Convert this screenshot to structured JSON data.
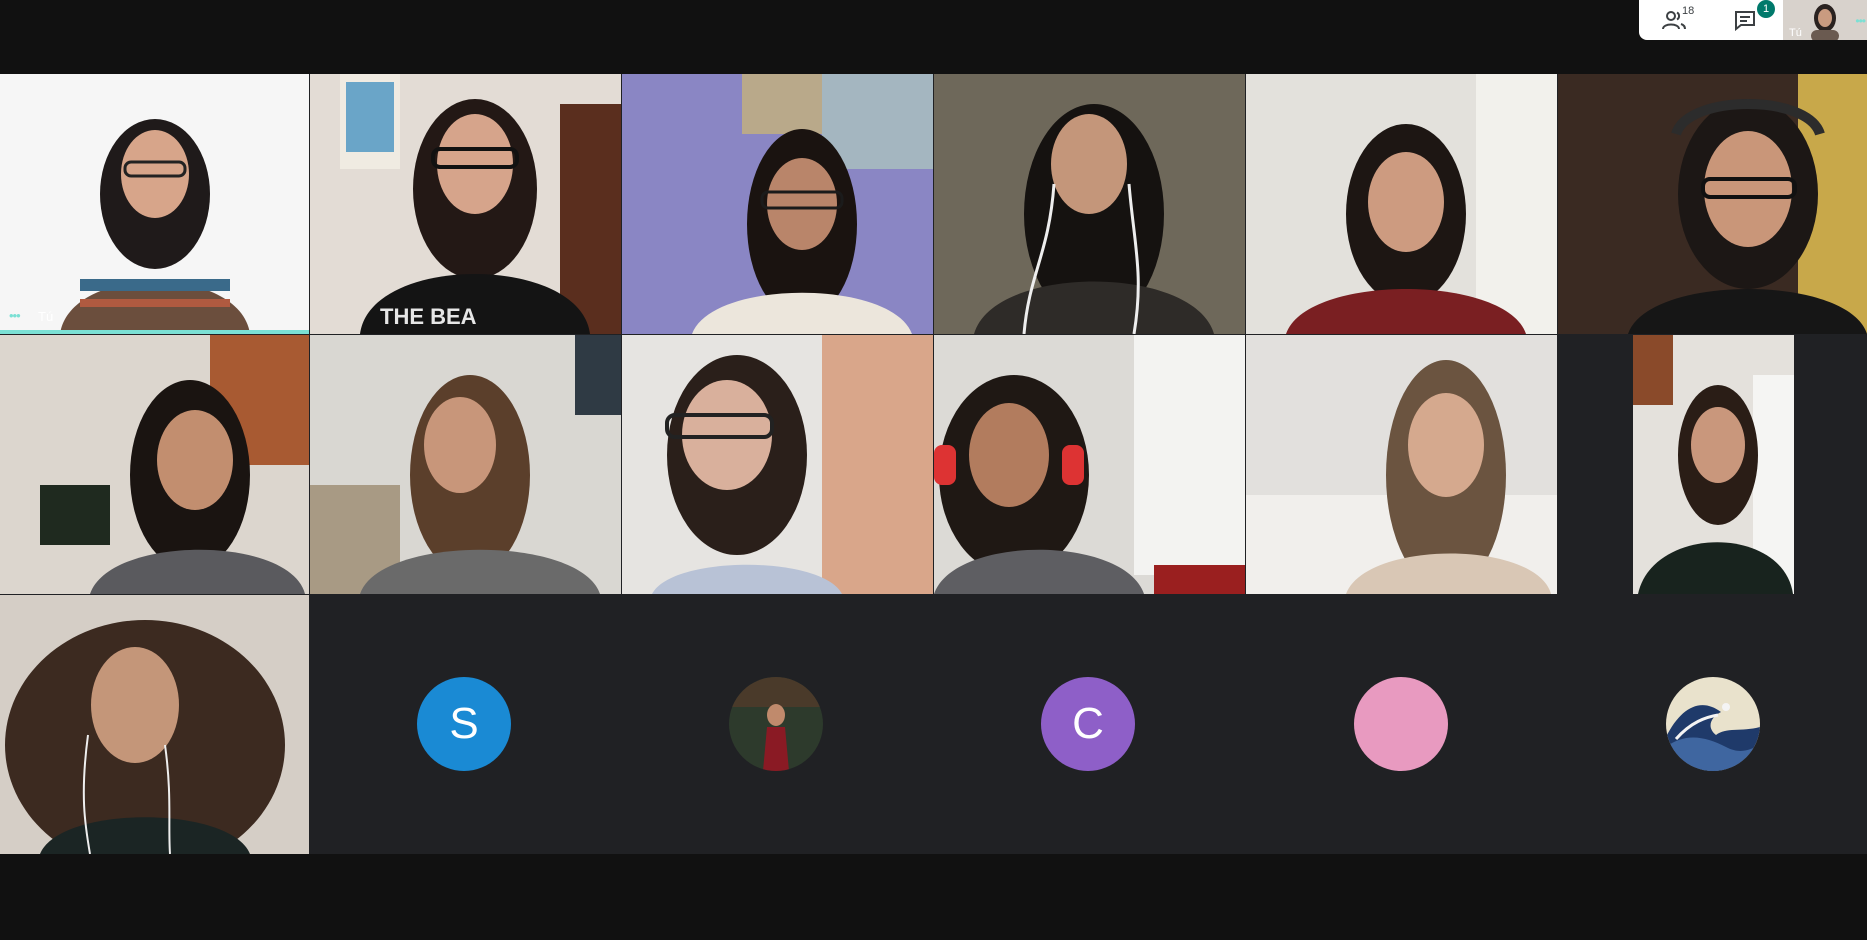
{
  "toolbar": {
    "participants_count": "18",
    "chat_badge": "1",
    "self_label": "Tú"
  },
  "self_tile": {
    "label": "Tú"
  },
  "avatars": [
    {
      "letter": "S",
      "color": "#1a8ad4"
    },
    {
      "letter": "C",
      "color": "#8e5fc8"
    },
    {
      "letter": "",
      "color": "#e89ac0"
    }
  ],
  "colors": {
    "background": "#202124",
    "frame": "#111111",
    "speaking_indicator": "#7be0d4",
    "chat_badge": "#00796b"
  }
}
